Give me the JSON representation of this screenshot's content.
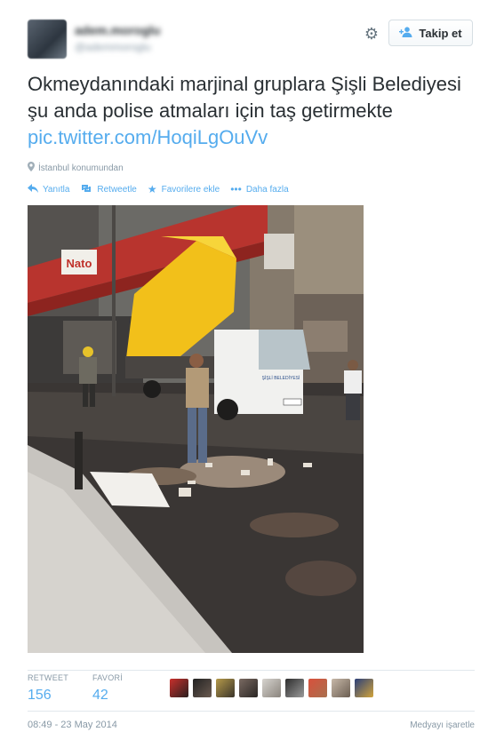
{
  "header": {
    "display_name": "adem.moroglu",
    "handle": "@ademmoroglu",
    "follow_label": "Takip et"
  },
  "tweet": {
    "text": "Okmeydanındaki marjinal gruplara Şişli Belediyesi şu anda polise atmaları için taş getirmekte",
    "link": "pic.twitter.com/HoqiLgOuVv",
    "location": "İstanbul konumundan"
  },
  "actions": [
    {
      "label": "Yanıtla",
      "icon": "reply-icon"
    },
    {
      "label": "Retweetle",
      "icon": "retweet-icon"
    },
    {
      "label": "Favorilere ekle",
      "icon": "star-icon"
    },
    {
      "label": "Daha fazla",
      "icon": "more-icon"
    }
  ],
  "photo": {
    "truck_text": "ŞİŞLİ BELEDİYESİ",
    "sign_text": "Nato"
  },
  "stats": {
    "retweet_label": "RETWEET",
    "retweet_count": "156",
    "favorite_label": "FAVORİ",
    "favorite_count": "42"
  },
  "footer": {
    "timestamp": "08:49 - 23 May 2014",
    "flag_media": "Medyayı işaretle"
  },
  "colors": {
    "link": "#55acee",
    "muted": "#8899a6",
    "text": "#292f33"
  }
}
